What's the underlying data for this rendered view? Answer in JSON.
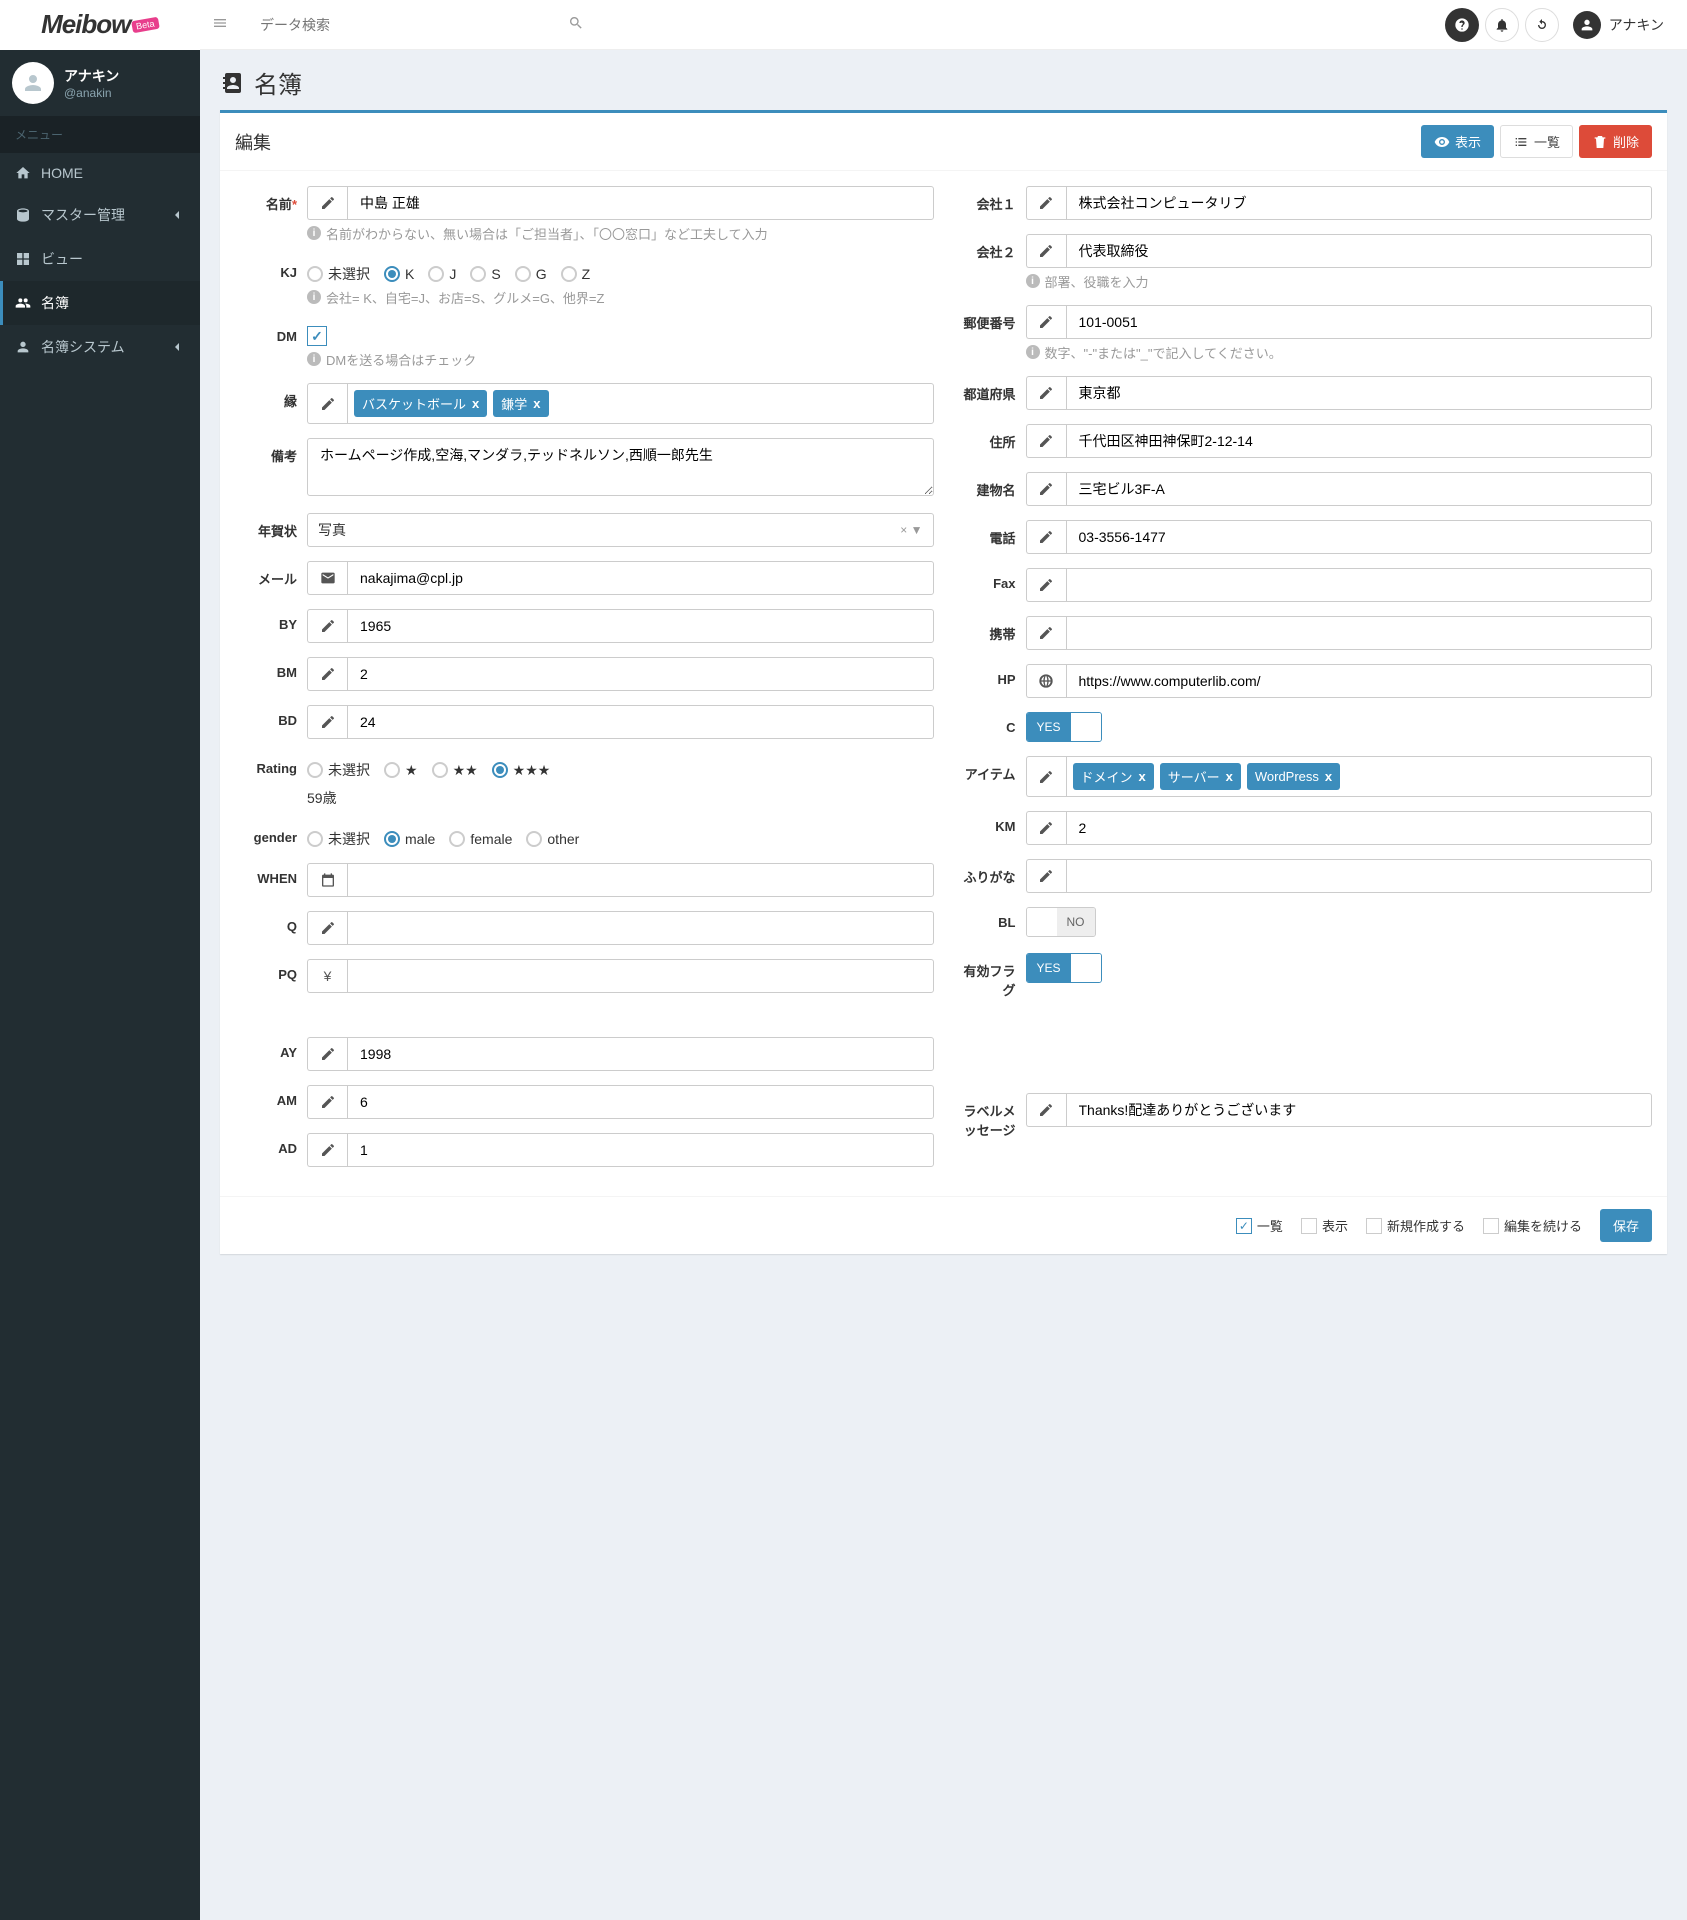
{
  "brand": "Meibow",
  "beta": "Beta",
  "search_placeholder": "データ検索",
  "top_user": "アナキン",
  "sidebar": {
    "user_name": "アナキン",
    "user_handle": "@anakin",
    "menu_label": "メニュー",
    "items": [
      {
        "label": "HOME"
      },
      {
        "label": "マスター管理"
      },
      {
        "label": "ビュー"
      },
      {
        "label": "名簿"
      },
      {
        "label": "名簿システム"
      }
    ]
  },
  "page": {
    "title": "名簿",
    "box_title": "編集",
    "btn_show": "表示",
    "btn_list": "一覧",
    "btn_delete": "削除"
  },
  "left": {
    "name_label": "名前",
    "name_value": "中島 正雄",
    "name_help": "名前がわからない、無い場合は「ご担当者」、「〇〇窓口」など工夫して入力",
    "kj_label": "KJ",
    "kj_options": [
      "未選択",
      "K",
      "J",
      "S",
      "G",
      "Z"
    ],
    "kj_selected": "K",
    "kj_help": "会社= K、自宅=J、お店=S、グルメ=G、他界=Z",
    "dm_label": "DM",
    "dm_help": "DMを送る場合はチェック",
    "en_label": "縁",
    "en_tags": [
      "バスケットボール",
      "鎌学"
    ],
    "biko_label": "備考",
    "biko_value": "ホームページ作成,空海,マンダラ,テッドネルソン,西順一郎先生",
    "nenga_label": "年賀状",
    "nenga_value": "写真",
    "mail_label": "メール",
    "mail_value": "nakajima@cpl.jp",
    "by_label": "BY",
    "by_value": "1965",
    "bm_label": "BM",
    "bm_value": "2",
    "bd_label": "BD",
    "bd_value": "24",
    "rating_label": "Rating",
    "rating_options": [
      "未選択",
      "★",
      "★★",
      "★★★"
    ],
    "rating_selected": "★★★",
    "age_text": "59歳",
    "gender_label": "gender",
    "gender_options": [
      "未選択",
      "male",
      "female",
      "other"
    ],
    "gender_selected": "male",
    "when_label": "WHEN",
    "q_label": "Q",
    "pq_label": "PQ",
    "ay_label": "AY",
    "ay_value": "1998",
    "am_label": "AM",
    "am_value": "6",
    "ad_label": "AD",
    "ad_value": "1"
  },
  "right": {
    "c1_label": "会社１",
    "c1_value": "株式会社コンピュータリブ",
    "c2_label": "会社２",
    "c2_value": "代表取締役",
    "c2_help": "部署、役職を入力",
    "zip_label": "郵便番号",
    "zip_value": "101-0051",
    "zip_help": "数字、\"-\"または\"_\"で記入してください。",
    "pref_label": "都道府県",
    "pref_value": "東京都",
    "addr_label": "住所",
    "addr_value": "千代田区神田神保町2-12-14",
    "bld_label": "建物名",
    "bld_value": "三宅ビル3F-A",
    "tel_label": "電話",
    "tel_value": "03-3556-1477",
    "fax_label": "Fax",
    "fax_value": "",
    "mob_label": "携帯",
    "mob_value": "",
    "hp_label": "HP",
    "hp_value": "https://www.computerlib.com/",
    "c_label": "C",
    "c_on": "YES",
    "item_label": "アイテム",
    "item_tags": [
      "ドメイン",
      "サーバー",
      "WordPress"
    ],
    "km_label": "KM",
    "km_value": "2",
    "furi_label": "ふりがな",
    "furi_value": "",
    "bl_label": "BL",
    "bl_off": "NO",
    "valid_label": "有効フラグ",
    "valid_on": "YES",
    "labelmsg_label": "ラベルメッセージ",
    "labelmsg_value": "Thanks!配達ありがとうございます"
  },
  "footer": {
    "cb_list": "一覧",
    "cb_show": "表示",
    "cb_new": "新規作成する",
    "cb_cont": "編集を続ける",
    "save": "保存"
  }
}
